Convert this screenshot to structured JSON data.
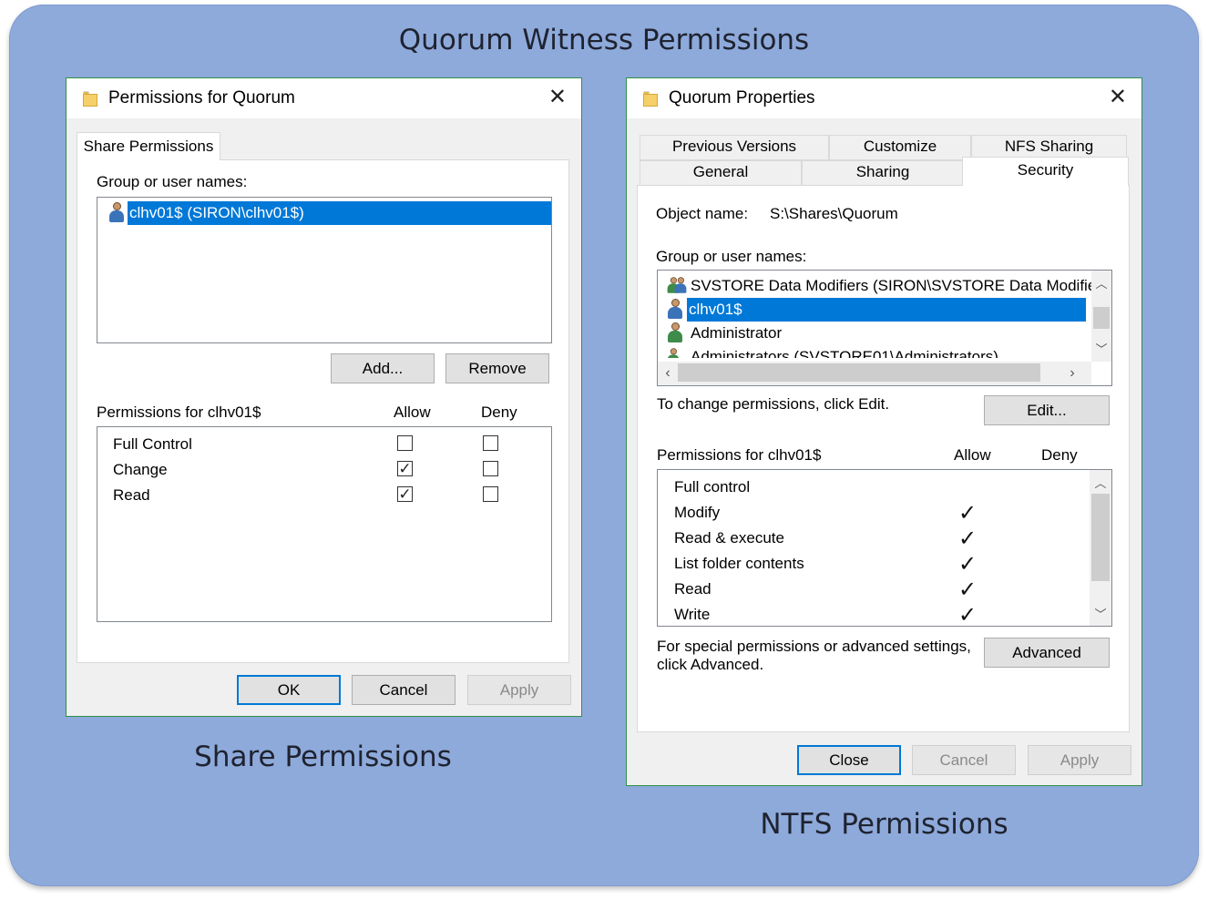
{
  "titles": {
    "main": "Quorum Witness Permissions",
    "share_caption": "Share Permissions",
    "ntfs_caption": "NTFS Permissions"
  },
  "share_dialog": {
    "title": "Permissions for Quorum",
    "tab": "Share Permissions",
    "group_label": "Group or user names:",
    "users": [
      "clhv01$ (SIRON\\clhv01$)"
    ],
    "add_button": "Add...",
    "remove_button": "Remove",
    "perm_label": "Permissions for clhv01$",
    "allow_header": "Allow",
    "deny_header": "Deny",
    "permissions": [
      {
        "name": "Full Control",
        "allow": false,
        "deny": false
      },
      {
        "name": "Change",
        "allow": true,
        "deny": false
      },
      {
        "name": "Read",
        "allow": true,
        "deny": false
      }
    ],
    "ok_button": "OK",
    "cancel_button": "Cancel",
    "apply_button": "Apply"
  },
  "ntfs_dialog": {
    "title": "Quorum Properties",
    "tabs_row1": [
      "Previous Versions",
      "Customize",
      "NFS Sharing"
    ],
    "tabs_row2": [
      "General",
      "Sharing",
      "Security"
    ],
    "object_label": "Object name:",
    "object_value": "S:\\Shares\\Quorum",
    "group_label": "Group or user names:",
    "users": [
      "SVSTORE Data Modifiers (SIRON\\SVSTORE Data Modifie",
      "clhv01$",
      "Administrator",
      "Administrators (SVSTORE01\\Administrators)"
    ],
    "change_text": "To change permissions, click Edit.",
    "edit_button": "Edit...",
    "perm_label": "Permissions for clhv01$",
    "allow_header": "Allow",
    "deny_header": "Deny",
    "permissions": [
      {
        "name": "Full control",
        "allow": false
      },
      {
        "name": "Modify",
        "allow": true
      },
      {
        "name": "Read & execute",
        "allow": true
      },
      {
        "name": "List folder contents",
        "allow": true
      },
      {
        "name": "Read",
        "allow": true
      },
      {
        "name": "Write",
        "allow": true
      }
    ],
    "special_text_1": "For special permissions or advanced settings,",
    "special_text_2": "click Advanced.",
    "advanced_button": "Advanced",
    "close_button": "Close",
    "cancel_button": "Cancel",
    "apply_button": "Apply"
  },
  "colors": {
    "background_panel": "#8eaadb",
    "selection": "#0078d7",
    "dialog_border": "#2f8f48"
  },
  "icons": {
    "check": "✓",
    "close": "✕"
  }
}
